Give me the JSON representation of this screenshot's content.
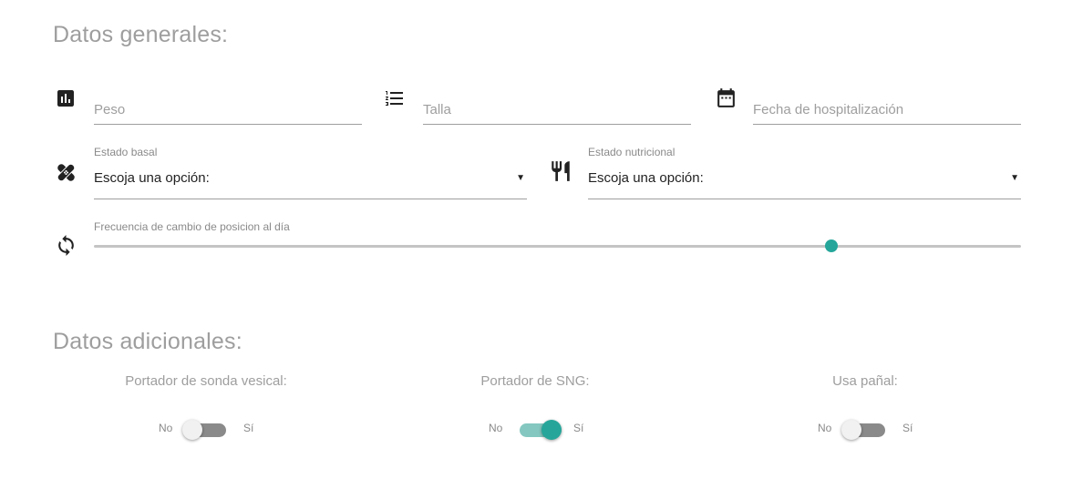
{
  "sections": {
    "general_title": "Datos generales:",
    "additional_title": "Datos adicionales:"
  },
  "fields": {
    "peso": {
      "placeholder": "Peso",
      "icon": "bar-chart-icon"
    },
    "talla": {
      "placeholder": "Talla",
      "icon": "numbered-list-icon"
    },
    "fecha": {
      "placeholder": "Fecha de hospitalización",
      "icon": "calendar-icon"
    }
  },
  "selects": {
    "estado_basal": {
      "label": "Estado basal",
      "value": "Escoja una opción:",
      "icon": "bandage-icon"
    },
    "estado_nutricional": {
      "label": "Estado nutricional",
      "value": "Escoja una opción:",
      "icon": "restaurant-icon"
    }
  },
  "slider": {
    "label": "Frecuencia de cambio de posicion al día",
    "icon": "sync-icon",
    "value_fraction": 0.795
  },
  "switches": [
    {
      "title": "Portador de sonda vesical:",
      "off_label": "No",
      "on_label": "Sí",
      "checked": false
    },
    {
      "title": "Portador de SNG:",
      "off_label": "No",
      "on_label": "Sí",
      "checked": true
    },
    {
      "title": "Usa pañal:",
      "off_label": "No",
      "on_label": "Sí",
      "checked": false
    }
  ],
  "colors": {
    "accent": "#26a69a",
    "accent_light": "#84c7c0",
    "muted_text": "#9e9e9e"
  }
}
